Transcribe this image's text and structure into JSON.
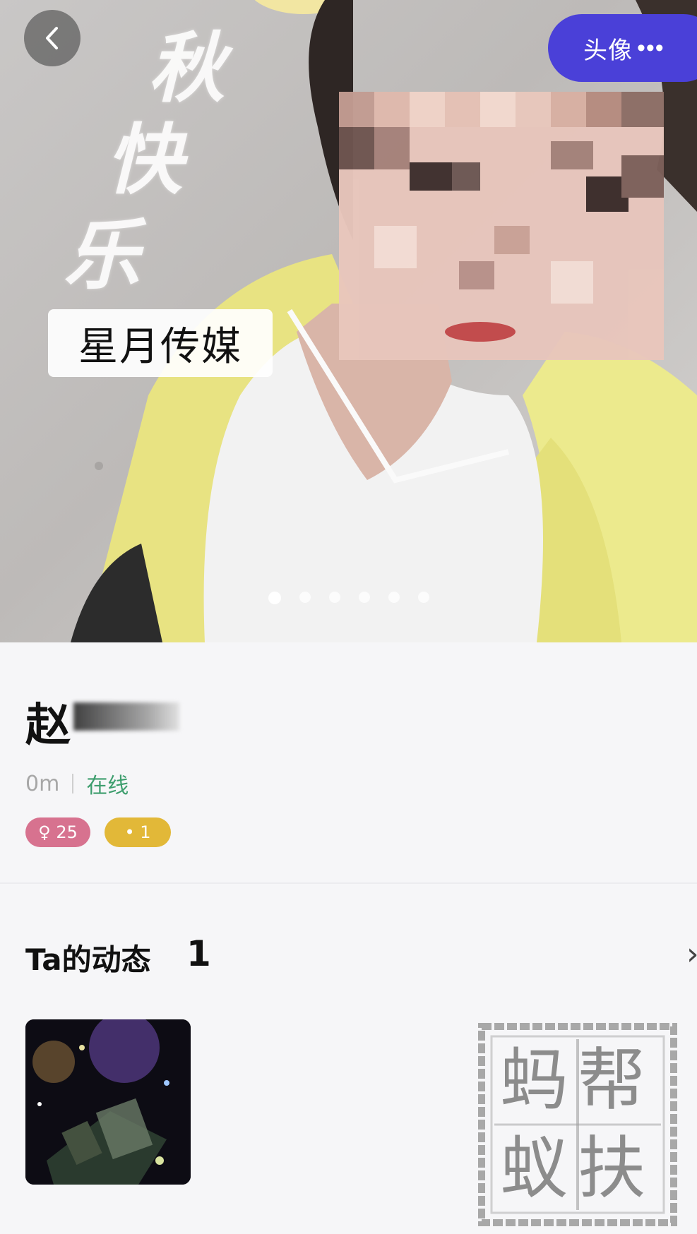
{
  "header": {
    "back_icon": "chevron-left-icon",
    "badge_label": "头像",
    "badge_suffix": "•••"
  },
  "photo": {
    "background_characters": [
      "秋",
      "快",
      "乐"
    ],
    "watermark_tag": "星月传媒",
    "indicator_count": 6,
    "active_index": 0
  },
  "profile": {
    "name": "赵",
    "distance": "0m",
    "status": "在线",
    "tags": [
      {
        "label": "♀ 25",
        "color": "#d7728f"
      },
      {
        "label": "• 1",
        "color": "#e2b838"
      }
    ]
  },
  "moments": {
    "title": "Ta的动态",
    "count": "1",
    "arrow": "›"
  },
  "seal": {
    "characters": [
      "蚂",
      "蚁",
      "帮",
      "扶"
    ]
  },
  "colors": {
    "badge": "#4a40d8",
    "online": "#3e9e6e"
  }
}
